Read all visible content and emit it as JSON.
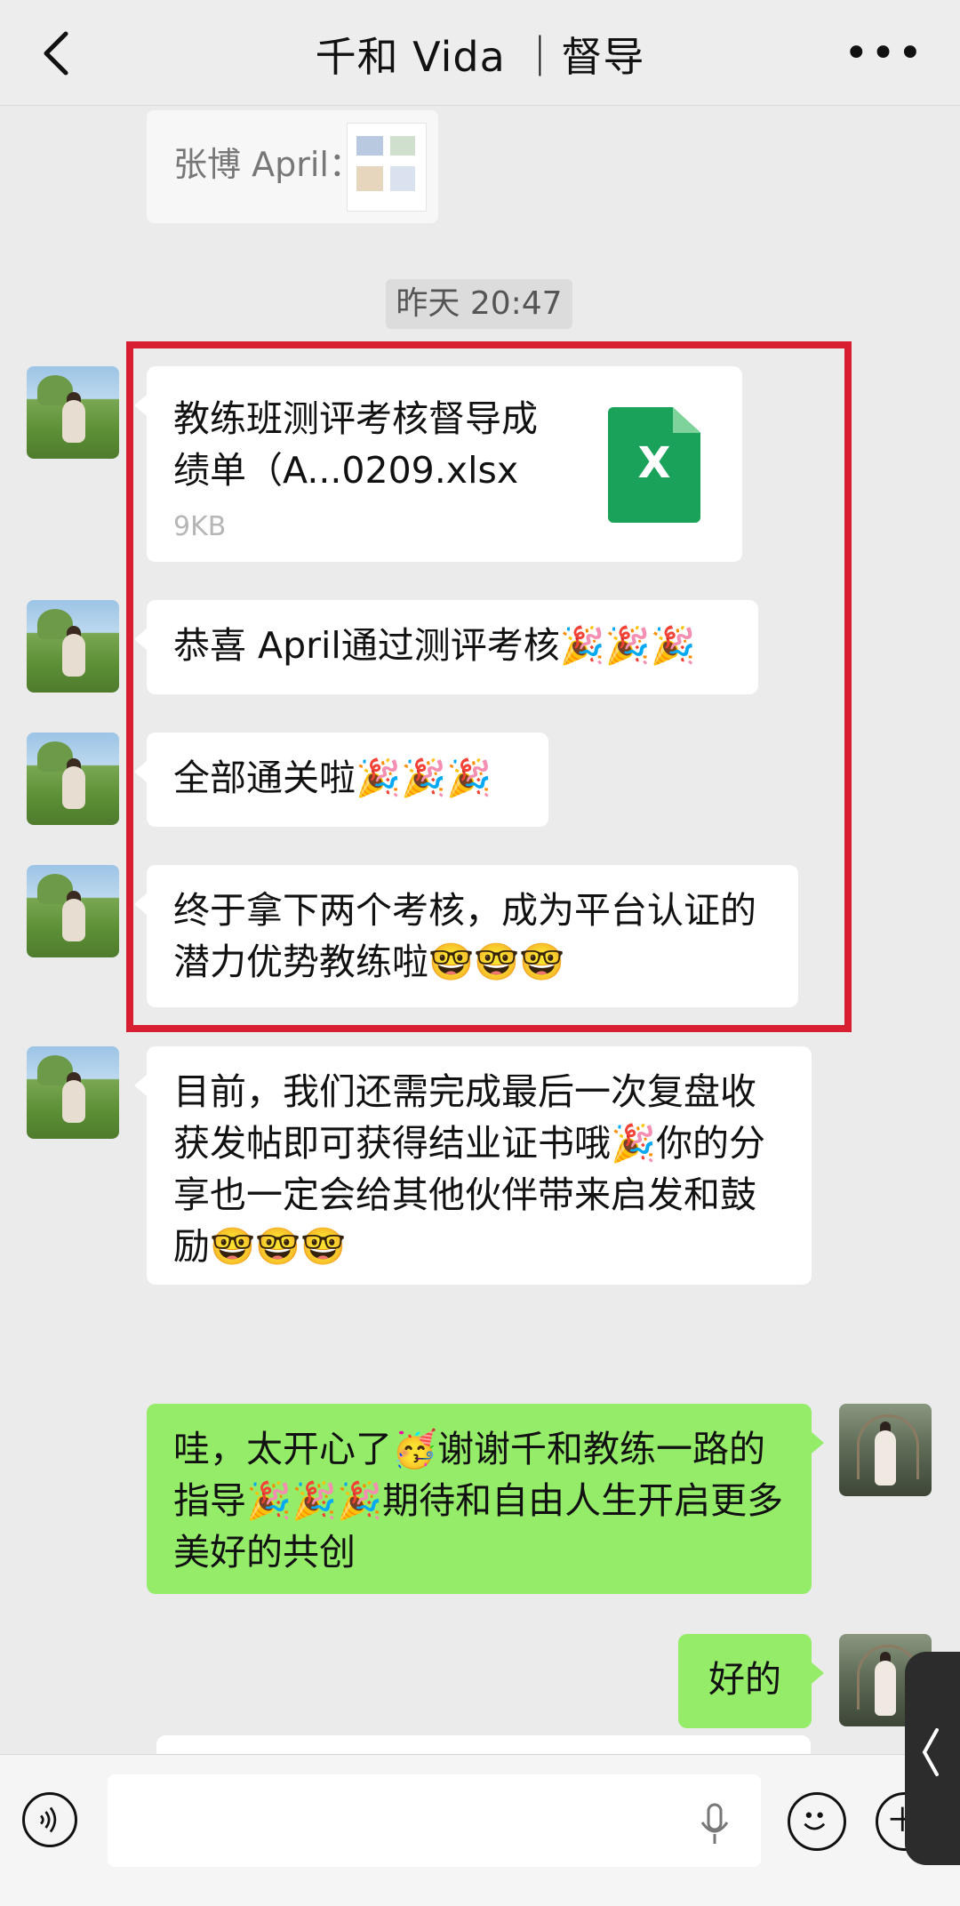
{
  "header": {
    "title": "千和 Vida ｜督导",
    "more_label": "•••"
  },
  "quote": {
    "label": "张博 April："
  },
  "timestamp": "昨天 20:47",
  "messages": [
    {
      "type": "file",
      "sender": "coach",
      "file_name": "教练班测评考核督导成绩单（A...0209.xlsx",
      "file_size": "9KB",
      "icon": "excel-file-icon"
    },
    {
      "type": "text",
      "sender": "coach",
      "text": "恭喜 April通过测评考核🎉🎉🎉"
    },
    {
      "type": "text",
      "sender": "coach",
      "text": "全部通关啦🎉🎉🎉"
    },
    {
      "type": "text",
      "sender": "coach",
      "text": "终于拿下两个考核，成为平台认证的潜力优势教练啦🤓🤓🤓"
    },
    {
      "type": "text",
      "sender": "coach",
      "text": "目前，我们还需完成最后一次复盘收获发帖即可获得结业证书哦🎉你的分享也一定会给其他伙伴带来启发和鼓励🤓🤓🤓"
    },
    {
      "type": "text",
      "sender": "me",
      "text": "哇，太开心了🥳谢谢千和教练一路的指导🎉🎉🎉期待和自由人生开启更多美好的共创"
    },
    {
      "type": "text",
      "sender": "me",
      "text": "好的"
    }
  ],
  "inputbar": {
    "voice_icon": "voice-icon",
    "mic_icon": "mic-icon",
    "emoji_icon": "emoji-icon",
    "plus_icon": "plus-icon"
  },
  "colors": {
    "my_bubble": "#95ec69",
    "highlight_box": "#d81e31"
  }
}
